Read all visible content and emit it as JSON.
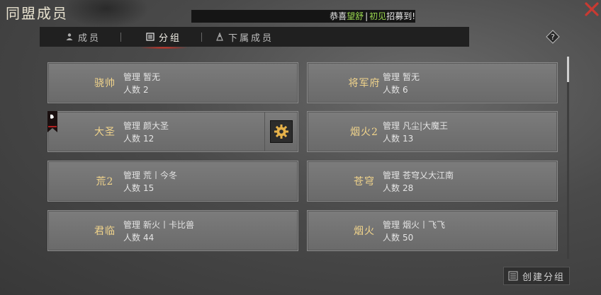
{
  "header": {
    "title": "同盟成员",
    "ticker_prefix": "恭喜",
    "ticker_name1": "望舒",
    "ticker_sep": "|",
    "ticker_name2": "初见",
    "ticker_suffix": "招募到!",
    "close_icon": "close-icon"
  },
  "tabs": [
    {
      "label": "成员",
      "icon": "member-icon",
      "active": false
    },
    {
      "label": "分组",
      "icon": "group-icon",
      "active": true
    },
    {
      "label": "下属成员",
      "icon": "subordinate-icon",
      "active": false
    }
  ],
  "help_icon": "question-icon",
  "labels": {
    "manager": "管理",
    "count": "人数"
  },
  "groups": [
    {
      "name": "骁帅",
      "manager": "暂无",
      "count": "2"
    },
    {
      "name": "将军府",
      "manager": "暂无",
      "count": "6"
    },
    {
      "name": "大圣",
      "manager": "颜大圣",
      "count": "12",
      "own": true
    },
    {
      "name": "烟火2",
      "manager": "凡尘|大魔王",
      "count": "13"
    },
    {
      "name": "荒2",
      "manager": "荒丨今冬",
      "count": "15"
    },
    {
      "name": "苍穹",
      "manager": "苍穹乂大江南",
      "count": "28"
    },
    {
      "name": "君临",
      "manager": "新火丨卡比兽",
      "count": "44"
    },
    {
      "name": "烟火",
      "manager": "烟火丨飞飞",
      "count": "50"
    }
  ],
  "create_button": {
    "label": "创建分组",
    "icon": "list-icon"
  },
  "colors": {
    "accent_gold": "#f1d48b",
    "highlight_green": "#9bd94f",
    "close_red": "#c83a32",
    "tab_active_red": "#e03a2a"
  }
}
